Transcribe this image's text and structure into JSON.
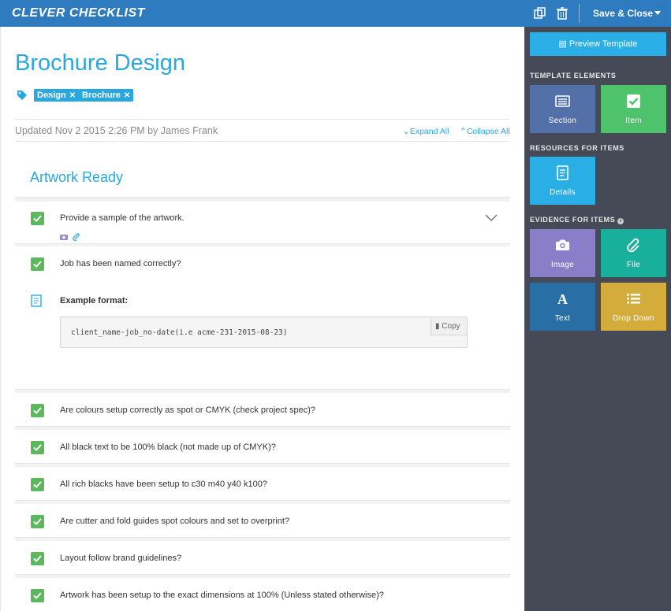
{
  "app": {
    "logo": "CLEVER CHECKLIST",
    "save_close": "Save & Close"
  },
  "page": {
    "title": "Brochure Design",
    "tags": [
      "Design",
      "Brochure"
    ],
    "updated": "Updated Nov 2 2015 2:26 PM by James Frank",
    "expand_all": "Expand All",
    "collapse_all": "Collapse All"
  },
  "section": {
    "title": "Artwork Ready"
  },
  "items": [
    "Provide a sample of the artwork.",
    "Job has been named correctly?",
    "Are colours setup correctly as spot or CMYK (check project spec)?",
    "All black text to be 100% black (not made up of CMYK)?",
    "All rich blacks have been setup to c30 m40 y40 k100?",
    "Are cutter and fold guides spot colours and set to overprint?",
    "Layout follow brand guidelines?",
    "Artwork has been setup to the exact dimensions at 100% (Unless stated otherwise)?"
  ],
  "details": {
    "label": "Example format:",
    "code": "client_name-job_no-date(i.e acme-231-2015-08-23)",
    "copy": "Copy"
  },
  "sidebar": {
    "preview": "Preview Template",
    "template_heading": "TEMPLATE ELEMENTS",
    "resources_heading": "RESOURCES FOR ITEMS",
    "evidence_heading": "EVIDENCE FOR ITEMS",
    "tiles": {
      "section": "Section",
      "item": "Item",
      "details": "Details",
      "image": "Image",
      "file": "File",
      "text": "Text",
      "dropdown": "Drop Down"
    }
  },
  "colors": {
    "topbar": "#2e7cbf",
    "accent": "#29a8e0",
    "check": "#5cb85c",
    "sidebar": "#454a56",
    "tile_section": "#5470a8",
    "tile_item": "#4fc26c",
    "tile_details": "#29aee6",
    "tile_image": "#8b7ec8",
    "tile_file": "#18b09a",
    "tile_text": "#2a6ea6",
    "tile_dropdown": "#d4ac3c"
  }
}
